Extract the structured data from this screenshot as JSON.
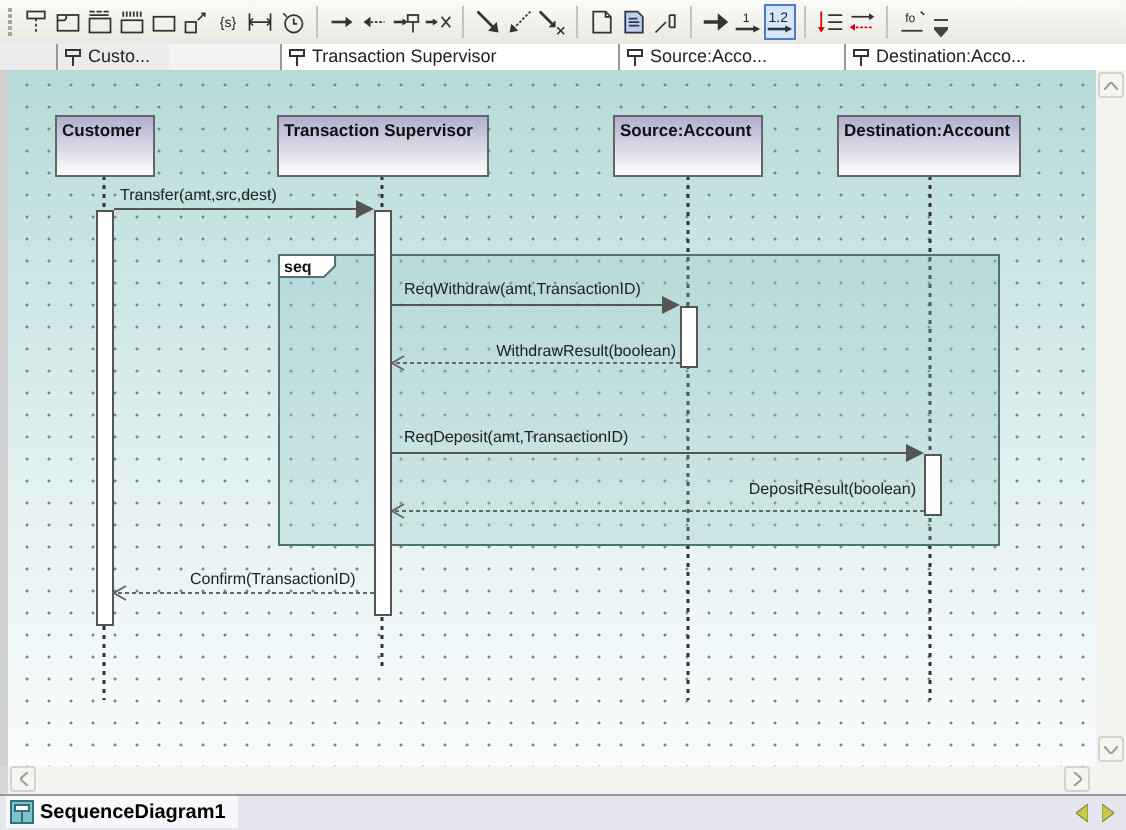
{
  "toolbar": [
    {
      "buttons": [
        {
          "kind": "lifeline",
          "selected": false
        },
        {
          "kind": "frame",
          "selected": false
        },
        {
          "kind": "fragment",
          "selected": false
        },
        {
          "kind": "ref",
          "selected": false
        },
        {
          "kind": "rect",
          "selected": false
        },
        {
          "kind": "gate",
          "selected": false
        },
        {
          "kind": "state",
          "glyph": "{s}",
          "selected": false
        },
        {
          "kind": "duration",
          "selected": false
        },
        {
          "kind": "timer",
          "selected": false
        }
      ]
    },
    {
      "buttons": [
        {
          "kind": "msg-right",
          "selected": false
        },
        {
          "kind": "msg-left",
          "selected": false
        },
        {
          "kind": "msg-create",
          "selected": false
        },
        {
          "kind": "msg-destroy",
          "selected": false
        }
      ]
    },
    {
      "buttons": [
        {
          "kind": "diag",
          "selected": false
        },
        {
          "kind": "diag-return",
          "selected": false
        },
        {
          "kind": "diag-lost",
          "selected": false
        }
      ]
    },
    {
      "buttons": [
        {
          "kind": "note",
          "selected": false
        },
        {
          "kind": "note-link",
          "selected": false
        },
        {
          "kind": "constraint",
          "selected": false
        }
      ]
    },
    {
      "buttons": [
        {
          "kind": "plain-arrow",
          "selected": false
        },
        {
          "kind": "num-arrow",
          "glyph": "1",
          "selected": false
        },
        {
          "kind": "num-arrow",
          "glyph": "1.2",
          "selected": true
        }
      ]
    },
    {
      "buttons": [
        {
          "kind": "reorder-red",
          "selected": false
        },
        {
          "kind": "reorder",
          "selected": false
        }
      ]
    },
    {
      "buttons": [
        {
          "kind": "formula",
          "glyph": "fo",
          "selected": false
        }
      ]
    }
  ],
  "lifeline_headers": [
    {
      "label": "Custo..."
    },
    {
      "label": "Transaction Supervisor"
    },
    {
      "label": "Source:Acco..."
    },
    {
      "label": "Destination:Acco..."
    }
  ],
  "lifelines": [
    {
      "name": "Customer"
    },
    {
      "name": "Transaction Supervisor"
    },
    {
      "name": "Source:Account"
    },
    {
      "name": "Destination:Account"
    }
  ],
  "fragment": {
    "operator": "seq"
  },
  "messages": [
    {
      "label": "Transfer(amt,src,dest)",
      "kind": "call"
    },
    {
      "label": "ReqWithdraw(amt,TransactionID)",
      "kind": "call"
    },
    {
      "label": "WithdrawResult(boolean)",
      "kind": "return"
    },
    {
      "label": "ReqDeposit(amt,TransactionID)",
      "kind": "call"
    },
    {
      "label": "DepositResult(boolean)",
      "kind": "return"
    },
    {
      "label": "Confirm(TransactionID)",
      "kind": "return"
    }
  ],
  "document_tabs": [
    {
      "label": "SequenceDiagram1",
      "selected": true
    }
  ]
}
